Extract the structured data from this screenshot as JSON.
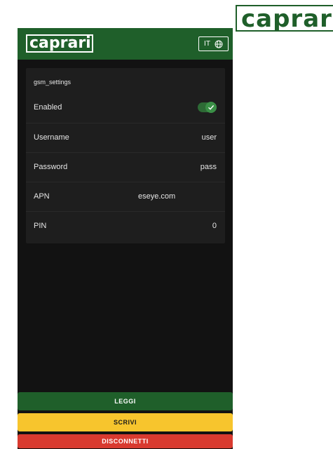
{
  "logo": {
    "corner_text": "caprari",
    "header_text": "caprari"
  },
  "header": {
    "language_label": "IT",
    "language_icon": "globe-icon"
  },
  "settings": {
    "title": "gsm_settings",
    "rows": [
      {
        "label": "Enabled",
        "type": "toggle",
        "value": true
      },
      {
        "label": "Username",
        "type": "text",
        "value": "user"
      },
      {
        "label": "Password",
        "type": "text",
        "value": "pass"
      },
      {
        "label": "APN",
        "type": "text",
        "value": "eseye.com"
      },
      {
        "label": "PIN",
        "type": "text",
        "value": "0"
      }
    ]
  },
  "actions": {
    "leggi": "LEGGI",
    "scrivi": "SCRIVI",
    "disconnetti": "DISCONNETTI"
  },
  "colors": {
    "brand_green": "#1f5f2a",
    "background": "#121212",
    "card": "#1e1e1e",
    "write_yellow": "#f7c52d",
    "disconnect_red": "#d93a2f",
    "toggle_on": "#3a8f46"
  }
}
